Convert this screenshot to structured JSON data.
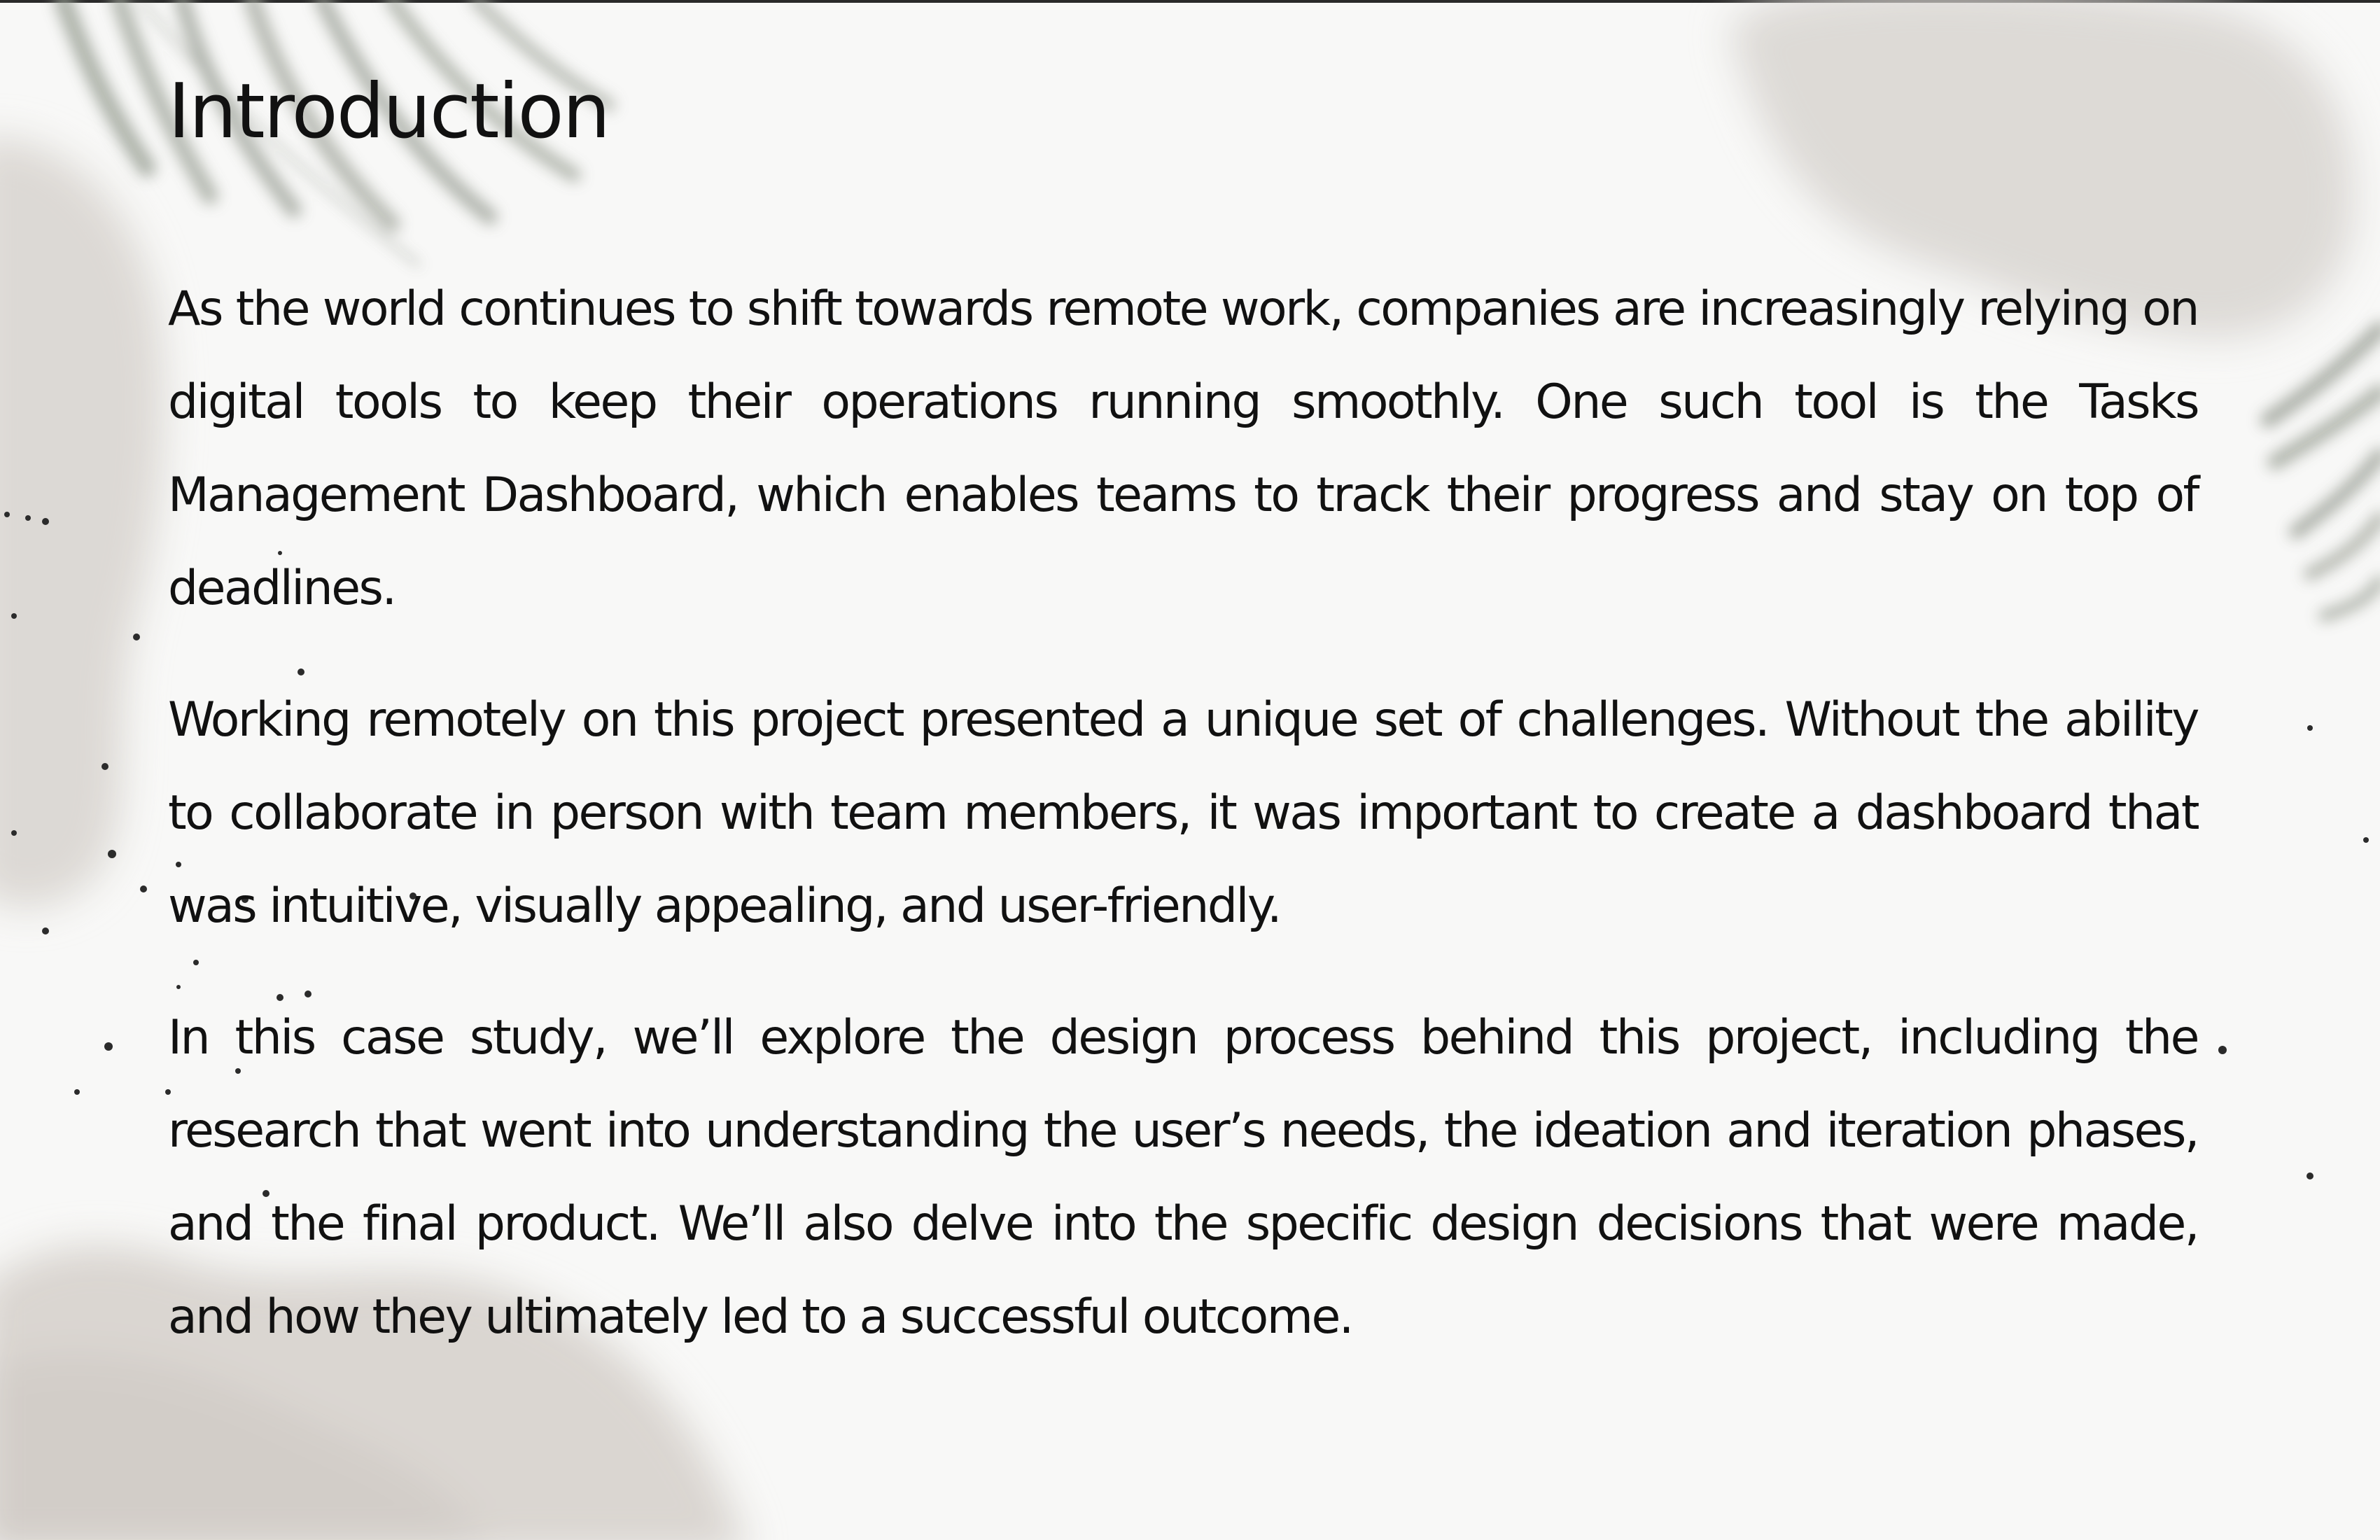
{
  "page": {
    "title": "Introduction",
    "paragraphs": [
      "As the world continues to shift towards remote work, companies are increasingly relying on digital tools to keep their operations running smoothly. One such tool is the Tasks Management Dashboard, which enables teams to track their progress and stay on top of deadlines.",
      "Working remotely on this project presented a unique set of challenges. Without the ability to collaborate in person with team members, it was important to create a dashboard that was intuitive, visually appealing, and user-friendly.",
      "In this case study, we’ll explore the design process behind this project, including the research that went into understanding the user’s needs, the ideation and iteration phases, and the final product. We’ll also delve into the specific design decisions that were made, and how they ultimately led to a successful outcome."
    ]
  },
  "colors": {
    "background": "#f8f8f7",
    "text": "#111111",
    "watercolor": "#d9d6d1",
    "leaf": "#9ea39a"
  }
}
